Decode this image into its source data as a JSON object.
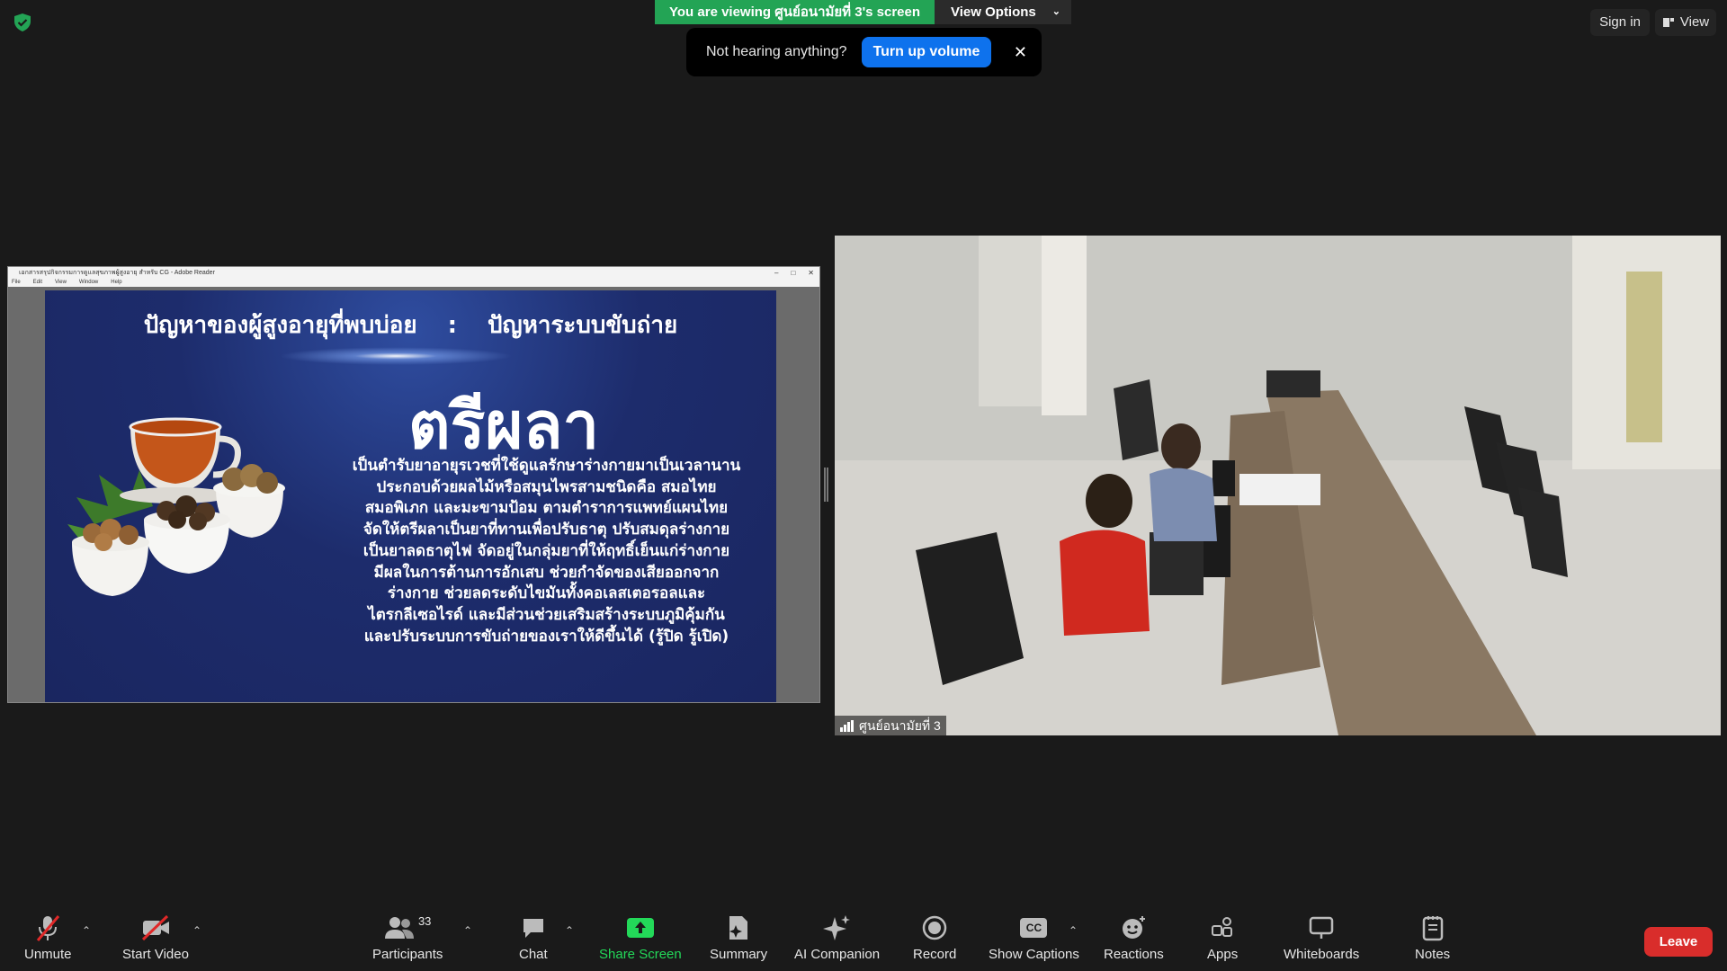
{
  "top": {
    "viewing_label": "You are viewing ศูนย์อนามัยที่ 3's screen",
    "view_options": "View Options",
    "sign_in": "Sign in",
    "view": "View"
  },
  "notice": {
    "text": "Not hearing anything?",
    "button": "Turn up volume",
    "close": "✕"
  },
  "reader": {
    "title": "เอกสารสรุปกิจกรรมการดูแลสุขภาพผู้สูงอายุ สำหรับ CG - Adobe Reader",
    "menu": [
      "File",
      "Edit",
      "View",
      "Window",
      "Help"
    ]
  },
  "slide": {
    "heading_left": "ปัญหาของผู้สูงอายุที่พบบ่อย",
    "heading_sep": ":",
    "heading_right": "ปัญหาระบบขับถ่าย",
    "title": "ตรีผลา",
    "body": [
      "เป็นตำรับยาอายุรเวชที่ใช้ดูแลรักษาร่างกายมาเป็นเวลานาน",
      "ประกอบด้วยผลไม้หรือสมุนไพรสามชนิดคือ สมอไทย",
      "สมอพิเภก และมะขามป้อม ตามตำราการแพทย์แผนไทย",
      "จัดให้ตรีผลาเป็นยาที่ทานเพื่อปรับธาตุ ปรับสมดุลร่างกาย",
      "เป็นยาลดธาตุไฟ จัดอยู่ในกลุ่มยาที่ให้ฤทธิ์เย็นแก่ร่างกาย",
      "มีผลในการต้านการอักเสบ ช่วยกำจัดของเสียออกจาก",
      "ร่างกาย ช่วยลดระดับไขมันทั้งคอเลสเตอรอลและ",
      "ไตรกลีเซอไรด์ และมีส่วนช่วยเสริมสร้างระบบภูมิคุ้มกัน",
      "และปรับระบบการขับถ่ายของเราให้ดีขึ้นได้ (รู้ปิด รู้เปิด)"
    ]
  },
  "video": {
    "participant_name": "ศูนย์อนามัยที่ 3"
  },
  "toolbar": {
    "unmute": "Unmute",
    "start_video": "Start Video",
    "participants": "Participants",
    "participant_count": "33",
    "chat": "Chat",
    "share_screen": "Share Screen",
    "summary": "Summary",
    "ai_companion": "AI Companion",
    "record": "Record",
    "show_captions": "Show Captions",
    "cc_icon_text": "CC",
    "reactions": "Reactions",
    "apps": "Apps",
    "whiteboards": "Whiteboards",
    "notes": "Notes",
    "leave": "Leave"
  },
  "colors": {
    "viewing_green": "#23a455",
    "accent_blue": "#0e72ed",
    "leave_red": "#d92d2b",
    "share_green": "#23d959"
  }
}
